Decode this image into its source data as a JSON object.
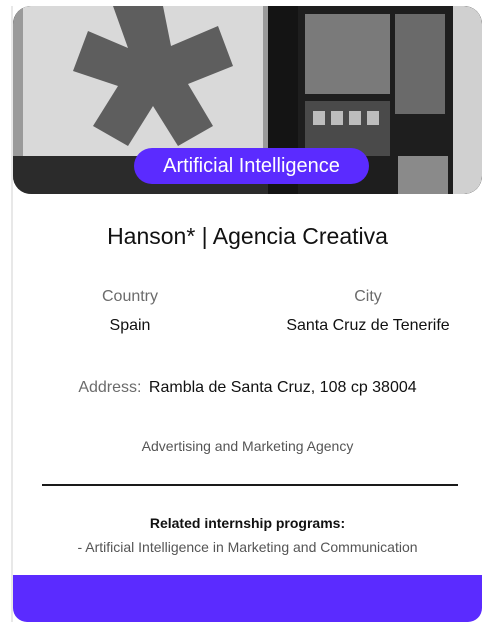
{
  "hero": {
    "image_name": "agency-storefront-photo",
    "category_label": "Artificial Intelligence"
  },
  "company": {
    "name": "Hanson* | Agencia Creativa",
    "country_label": "Country",
    "country": "Spain",
    "city_label": "City",
    "city": "Santa Cruz de Tenerife",
    "address_label": "Address:",
    "address": "Rambla de Santa Cruz, 108 cp 38004",
    "type": "Advertising and Marketing Agency"
  },
  "related": {
    "title": "Related internship programs:",
    "items": [
      "- Artificial Intelligence in Marketing and Communication"
    ]
  },
  "colors": {
    "accent": "#5b2bff",
    "text": "#111111",
    "muted": "#6b6b6b"
  }
}
